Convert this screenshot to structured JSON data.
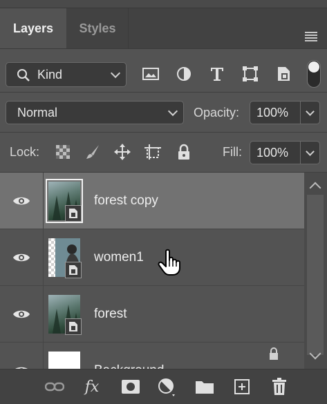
{
  "panel": {
    "tabs": [
      {
        "label": "Layers",
        "active": true
      },
      {
        "label": "Styles",
        "active": false
      }
    ],
    "menu_icon": "panel-menu-icon"
  },
  "filter": {
    "kind_label": "Kind",
    "icons": [
      "pixel-layer-filter-icon",
      "adjustment-layer-filter-icon",
      "type-layer-filter-icon",
      "shape-layer-filter-icon",
      "smart-object-filter-icon"
    ],
    "toggle_on": true
  },
  "blend": {
    "mode": "Normal",
    "opacity_label": "Opacity:",
    "opacity_value": "100%"
  },
  "lock": {
    "label": "Lock:",
    "icons": [
      "lock-transparent-pixels-icon",
      "lock-image-pixels-icon",
      "lock-position-icon",
      "lock-artboard-icon",
      "lock-all-icon"
    ],
    "fill_label": "Fill:",
    "fill_value": "100%"
  },
  "layers": [
    {
      "name": "forest copy",
      "selected": true,
      "visible": true,
      "thumb": "forest"
    },
    {
      "name": "women1",
      "selected": false,
      "visible": true,
      "thumb": "woman"
    },
    {
      "name": "forest",
      "selected": false,
      "visible": true,
      "thumb": "forest"
    },
    {
      "name": "Background",
      "selected": false,
      "visible": true,
      "thumb": "white"
    }
  ],
  "bottom_icons": [
    "link-layers-icon",
    "fx-icon",
    "add-mask-icon",
    "adjustment-layer-icon",
    "new-group-folder-icon",
    "new-layer-icon",
    "delete-trash-icon"
  ],
  "colors": {
    "panel": "#535353",
    "selected": "#727272",
    "header": "#424242"
  }
}
